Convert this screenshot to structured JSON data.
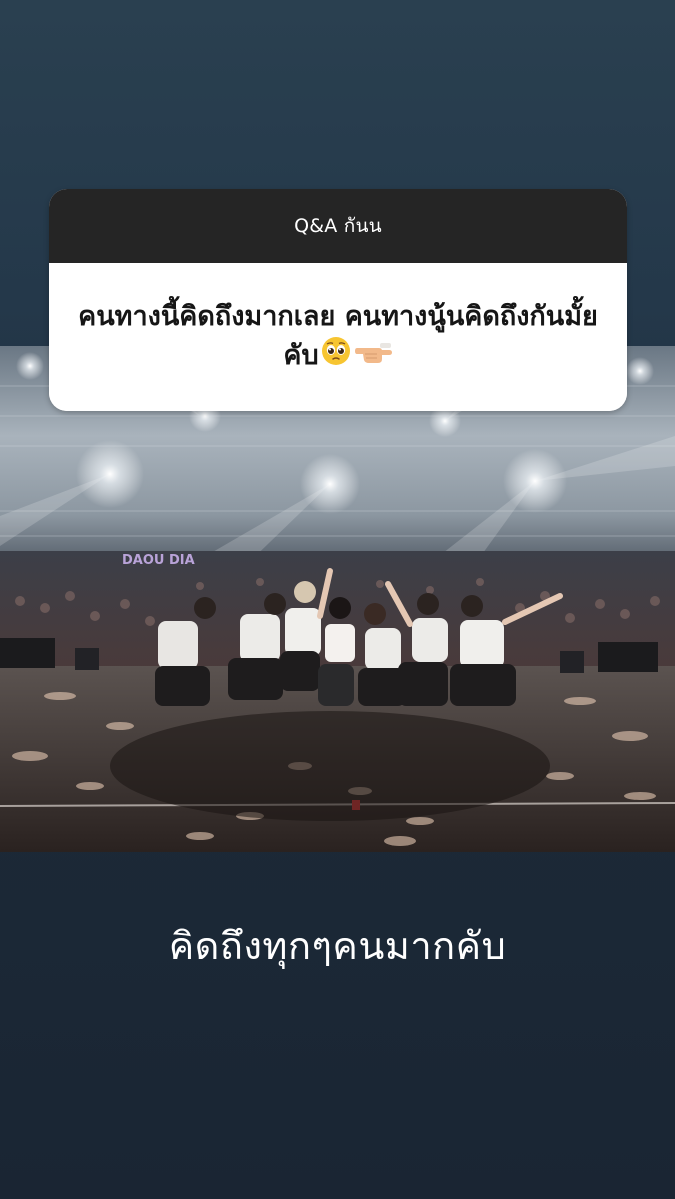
{
  "qa_sticker": {
    "title": "Q&A กันน",
    "question": "คนทางนี้คิดถึงมากเลย คนทางนู้นคิดถึงกันมั้ยคับ",
    "emojis": [
      "pleading-face-emoji",
      "pointing-hand-emoji"
    ]
  },
  "photo": {
    "stage_sign": "DAOU DIA"
  },
  "caption": "คิดถึงทุกๆคนมากคับ",
  "colors": {
    "background_top": "#2a4050",
    "background_bottom": "#1a2533",
    "card_header": "#252525",
    "card_body": "#ffffff"
  }
}
